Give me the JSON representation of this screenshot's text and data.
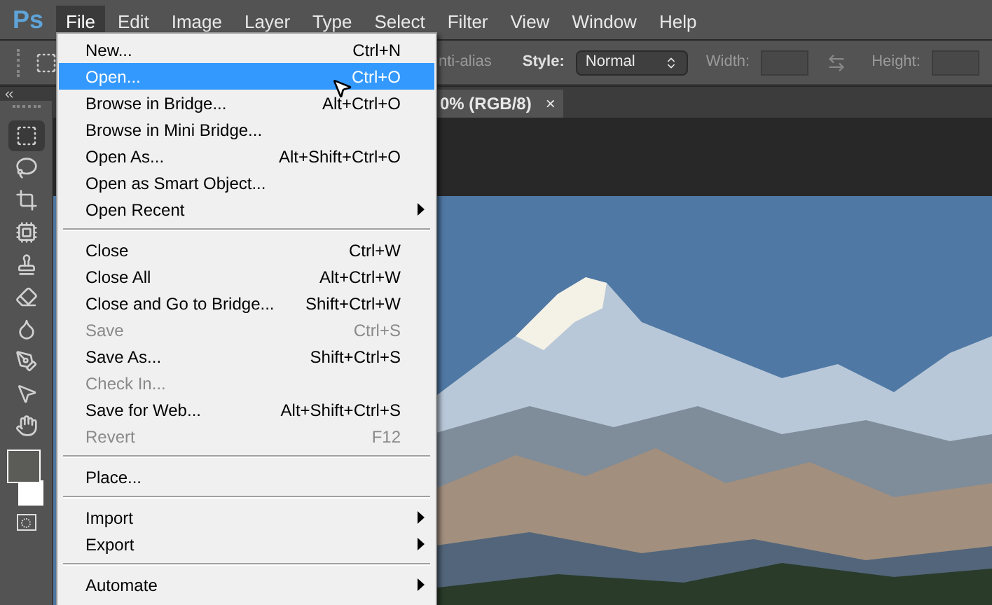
{
  "app_logo": "Ps",
  "menubar": [
    {
      "label": "File",
      "selected": true
    },
    {
      "label": "Edit",
      "selected": false
    },
    {
      "label": "Image",
      "selected": false
    },
    {
      "label": "Layer",
      "selected": false
    },
    {
      "label": "Type",
      "selected": false
    },
    {
      "label": "Select",
      "selected": false
    },
    {
      "label": "Filter",
      "selected": false
    },
    {
      "label": "View",
      "selected": false
    },
    {
      "label": "Window",
      "selected": false
    },
    {
      "label": "Help",
      "selected": false
    }
  ],
  "options_bar": {
    "antialias_label": "nti-alias",
    "style_label": "Style:",
    "style_value": "Normal",
    "width_label": "Width:",
    "height_label": "Height:"
  },
  "document_tab": {
    "title": "0% (RGB/8)",
    "close": "×"
  },
  "file_menu": [
    {
      "kind": "item",
      "label": "New...",
      "shortcut": "Ctrl+N",
      "disabled": false,
      "selected": false,
      "submenu": false
    },
    {
      "kind": "item",
      "label": "Open...",
      "shortcut": "Ctrl+O",
      "disabled": false,
      "selected": true,
      "submenu": false
    },
    {
      "kind": "item",
      "label": "Browse in Bridge...",
      "shortcut": "Alt+Ctrl+O",
      "disabled": false,
      "selected": false,
      "submenu": false
    },
    {
      "kind": "item",
      "label": "Browse in Mini Bridge...",
      "disabled": false,
      "selected": false,
      "submenu": false
    },
    {
      "kind": "item",
      "label": "Open As...",
      "shortcut": "Alt+Shift+Ctrl+O",
      "disabled": false,
      "selected": false,
      "submenu": false
    },
    {
      "kind": "item",
      "label": "Open as Smart Object...",
      "disabled": false,
      "selected": false,
      "submenu": false
    },
    {
      "kind": "item",
      "label": "Open Recent",
      "disabled": false,
      "selected": false,
      "submenu": true
    },
    {
      "kind": "separator"
    },
    {
      "kind": "item",
      "label": "Close",
      "shortcut": "Ctrl+W",
      "disabled": false,
      "selected": false,
      "submenu": false
    },
    {
      "kind": "item",
      "label": "Close All",
      "shortcut": "Alt+Ctrl+W",
      "disabled": false,
      "selected": false,
      "submenu": false
    },
    {
      "kind": "item",
      "label": "Close and Go to Bridge...",
      "shortcut": "Shift+Ctrl+W",
      "disabled": false,
      "selected": false,
      "submenu": false
    },
    {
      "kind": "item",
      "label": "Save",
      "shortcut": "Ctrl+S",
      "disabled": true,
      "selected": false,
      "submenu": false
    },
    {
      "kind": "item",
      "label": "Save As...",
      "shortcut": "Shift+Ctrl+S",
      "disabled": false,
      "selected": false,
      "submenu": false
    },
    {
      "kind": "item",
      "label": "Check In...",
      "disabled": true,
      "selected": false,
      "submenu": false
    },
    {
      "kind": "item",
      "label": "Save for Web...",
      "shortcut": "Alt+Shift+Ctrl+S",
      "disabled": false,
      "selected": false,
      "submenu": false
    },
    {
      "kind": "item",
      "label": "Revert",
      "shortcut": "F12",
      "disabled": true,
      "selected": false,
      "submenu": false
    },
    {
      "kind": "separator"
    },
    {
      "kind": "item",
      "label": "Place...",
      "disabled": false,
      "selected": false,
      "submenu": false
    },
    {
      "kind": "separator"
    },
    {
      "kind": "item",
      "label": "Import",
      "disabled": false,
      "selected": false,
      "submenu": true
    },
    {
      "kind": "item",
      "label": "Export",
      "disabled": false,
      "selected": false,
      "submenu": true
    },
    {
      "kind": "separator"
    },
    {
      "kind": "item",
      "label": "Automate",
      "disabled": false,
      "selected": false,
      "submenu": true
    }
  ]
}
